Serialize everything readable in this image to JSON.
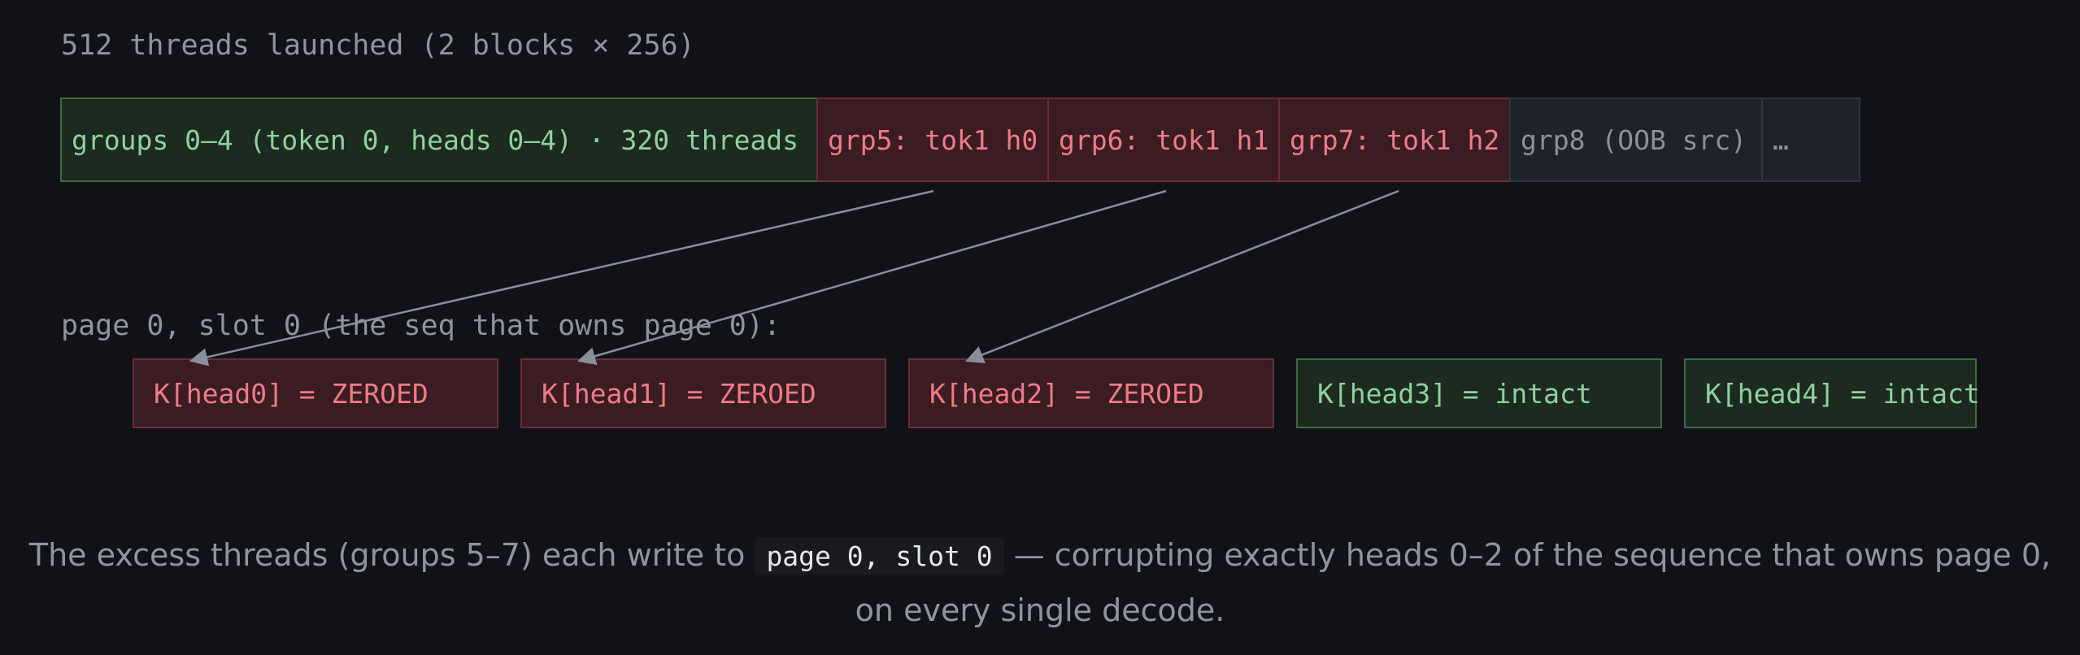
{
  "launch": {
    "caption": "512 threads launched (2 blocks × 256)"
  },
  "thread_groups": [
    {
      "label": "groups 0–4 (token 0, heads 0–4) · 320 threads",
      "kind": "ok"
    },
    {
      "label": "grp5: tok1 h0",
      "kind": "excess"
    },
    {
      "label": "grp6: tok1 h1",
      "kind": "excess"
    },
    {
      "label": "grp7: tok1 h2",
      "kind": "excess"
    },
    {
      "label": "grp8 (OOB src)",
      "kind": "oob"
    },
    {
      "label": "…",
      "kind": "more"
    }
  ],
  "slot": {
    "caption": "page 0, slot 0 (the seq that owns page 0):",
    "heads": [
      {
        "label": "K[head0] = ZEROED",
        "state": "zeroed"
      },
      {
        "label": "K[head1] = ZEROED",
        "state": "zeroed"
      },
      {
        "label": "K[head2] = ZEROED",
        "state": "zeroed"
      },
      {
        "label": "K[head3] = intact",
        "state": "intact"
      },
      {
        "label": "K[head4] = intact",
        "state": "intact"
      }
    ]
  },
  "footnote": {
    "before": "The excess threads (groups 5–7) each write to ",
    "code": "page 0, slot 0",
    "after": " — corrupting exactly heads 0–2 of the sequence that owns page 0, on every single decode."
  },
  "colors": {
    "background": "#111217",
    "ok_fill": "#1d2a1f",
    "ok_text": "#8fd19e",
    "excess_fill": "#3a1c22",
    "excess_text": "#ef7b88",
    "oob_fill": "#1e222b",
    "muted_text": "#8f949e",
    "arrow": "#8a8e9a"
  }
}
